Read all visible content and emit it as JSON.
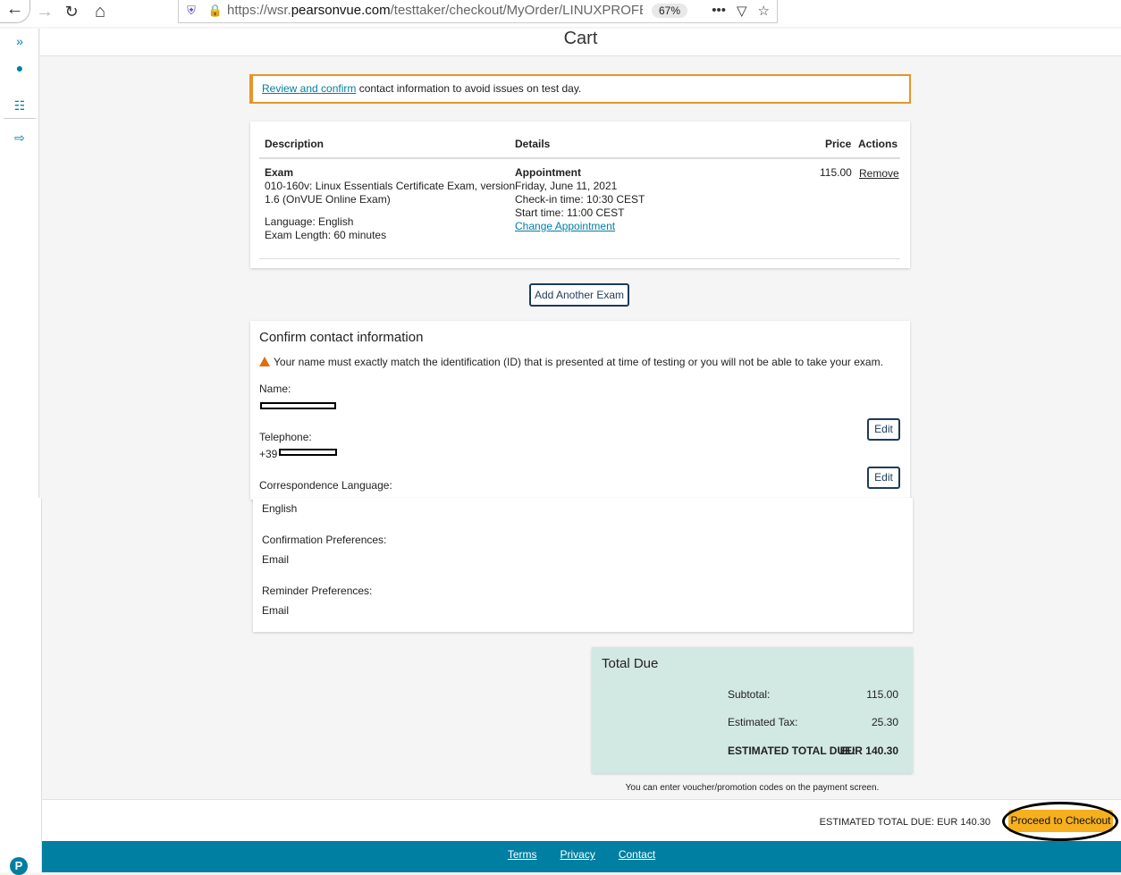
{
  "browser": {
    "url_prefix": "https://wsr.",
    "url_domain": "pearsonvue.com",
    "url_path": "/testtaker/checkout/MyOrder/LINUXPROFESSION",
    "zoom": "67%"
  },
  "page": {
    "title": "Cart"
  },
  "alert": {
    "link": "Review and confirm",
    "text": " contact information to avoid issues on test day."
  },
  "cart": {
    "headers": {
      "description": "Description",
      "details": "Details",
      "price": "Price",
      "actions": "Actions"
    },
    "item": {
      "type": "Exam",
      "name_line1": "010-160v: Linux Essentials Certificate Exam, version",
      "name_line2": "1.6 (OnVUE Online Exam)",
      "language": "Language: English",
      "length": "Exam Length: 60 minutes",
      "appointment_title": "Appointment",
      "date": "Friday, June 11, 2021",
      "checkin": "Check-in time: 10:30 CEST",
      "start": "Start time: 11:00 CEST",
      "change_link": "Change Appointment",
      "price": "115.00",
      "remove_link": "Remove"
    }
  },
  "add_exam_label": "Add Another Exam",
  "contact": {
    "title": "Confirm contact information",
    "warning": "Your name must exactly match the identification (ID) that is presented at time of testing or you will not be able to take your exam.",
    "name_label": "Name:",
    "telephone_label": "Telephone:",
    "telephone_prefix": "+39",
    "edit_label": "Edit",
    "correspondence_label": "Correspondence Language:",
    "correspondence_value": "English",
    "confirmation_label": "Confirmation Preferences:",
    "confirmation_value": "Email",
    "reminder_label": "Reminder Preferences:",
    "reminder_value": "Email"
  },
  "total": {
    "title": "Total Due",
    "subtotal_label": "Subtotal:",
    "subtotal_value": "115.00",
    "tax_label": "Estimated Tax:",
    "tax_value": "25.30",
    "grand_label": "ESTIMATED TOTAL DUE:",
    "grand_value": "EUR 140.30"
  },
  "voucher_note": "You can enter voucher/promotion codes on the payment screen.",
  "checkout": {
    "total_text": "ESTIMATED TOTAL DUE: EUR 140.30",
    "proceed_label": "Proceed to Checkout"
  },
  "footer": {
    "terms": "Terms",
    "privacy": "Privacy",
    "contact": "Contact"
  },
  "colors": {
    "accent": "#007fa3",
    "checkout_button": "#f6b01f",
    "total_bg": "#d2e8e3",
    "alert_border": "#e8942a"
  }
}
